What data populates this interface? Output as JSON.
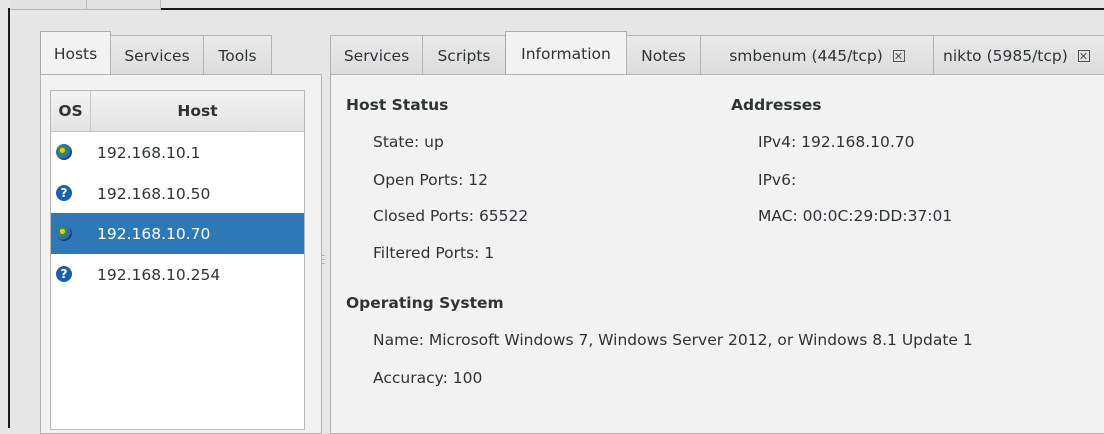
{
  "left_tabs": [
    "Hosts",
    "Services",
    "Tools"
  ],
  "right_tabs": [
    {
      "label": "Services",
      "closable": false
    },
    {
      "label": "Scripts",
      "closable": false
    },
    {
      "label": "Information",
      "closable": false
    },
    {
      "label": "Notes",
      "closable": false
    },
    {
      "label": "smbenum (445/tcp)",
      "closable": true
    },
    {
      "label": "nikto (5985/tcp)",
      "closable": true
    }
  ],
  "host_table": {
    "col_os": "OS",
    "col_host": "Host",
    "rows": [
      {
        "host": "192.168.10.1",
        "icon": "windows-icon",
        "selected": false
      },
      {
        "host": "192.168.10.50",
        "icon": "unknown-os-icon",
        "selected": false
      },
      {
        "host": "192.168.10.70",
        "icon": "windows-icon",
        "selected": true
      },
      {
        "host": "192.168.10.254",
        "icon": "unknown-os-icon",
        "selected": false
      }
    ]
  },
  "info": {
    "host_status_title": "Host Status",
    "state": "State: up",
    "open_ports": "Open Ports: 12",
    "closed_ports": "Closed Ports: 65522",
    "filtered_ports": "Filtered Ports: 1",
    "addresses_title": "Addresses",
    "ipv4": "IPv4: 192.168.10.70",
    "ipv6": "IPv6:",
    "mac": "MAC: 00:0C:29:DD:37:01",
    "os_title": "Operating System",
    "os_name": "Name: Microsoft Windows 7, Windows Server 2012, or Windows 8.1 Update 1",
    "accuracy": "Accuracy: 100"
  },
  "colors": {
    "selection": "#2e78b6",
    "background": "#e6e6e6",
    "panel": "#f2f2f2"
  }
}
